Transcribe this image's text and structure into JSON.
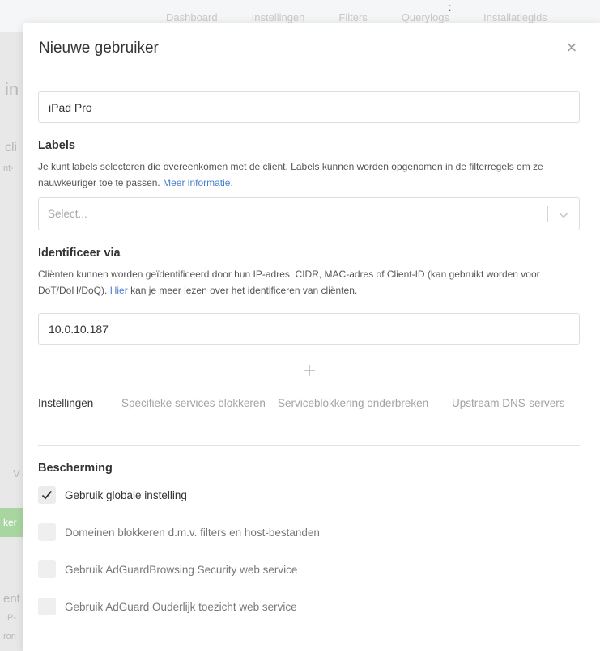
{
  "background": {
    "nav": [
      "Dashboard",
      "Instellingen",
      "Filters",
      "Querylogs",
      "Installatiegids"
    ],
    "fragments": {
      "a": "in",
      "b": "cli",
      "c": "nt-",
      "d": "V",
      "e": "ker",
      "f": "ent",
      "g": "IP-",
      "h": "ron"
    }
  },
  "modal": {
    "title": "Nieuwe gebruiker",
    "name_value": "iPad Pro",
    "labels": {
      "title": "Labels",
      "help": "Je kunt labels selecteren die overeenkomen met de client. Labels kunnen worden opgenomen in de filterregels om ze nauwkeuriger toe te passen.",
      "link": "Meer informatie.",
      "placeholder": "Select..."
    },
    "identify": {
      "title": "Identificeer via",
      "help_before": "Cliënten kunnen worden geïdentificeerd door hun IP-adres, CIDR, MAC-adres of Client-ID (kan gebruikt worden voor DoT/DoH/DoQ).",
      "link": "Hier",
      "help_after": "kan je meer lezen over het identificeren van cliënten.",
      "value": "10.0.10.187"
    },
    "tabs": [
      {
        "label": "Instellingen",
        "active": true
      },
      {
        "label": "Specifieke services blokkeren",
        "active": false
      },
      {
        "label": "Serviceblokkering onderbreken",
        "active": false
      },
      {
        "label": "Upstream DNS-servers",
        "active": false
      }
    ],
    "protection": {
      "title": "Bescherming",
      "options": [
        {
          "label": "Gebruik globale instelling",
          "checked": true
        },
        {
          "label": "Domeinen blokkeren d.m.v. filters en host-bestanden",
          "checked": false
        },
        {
          "label": "Gebruik AdGuardBrowsing Security web service",
          "checked": false
        },
        {
          "label": "Gebruik AdGuard Ouderlijk toezicht web service",
          "checked": false
        }
      ]
    }
  },
  "colors": {
    "link": "#467fcf",
    "muted_tab": "#a3a3a3"
  }
}
